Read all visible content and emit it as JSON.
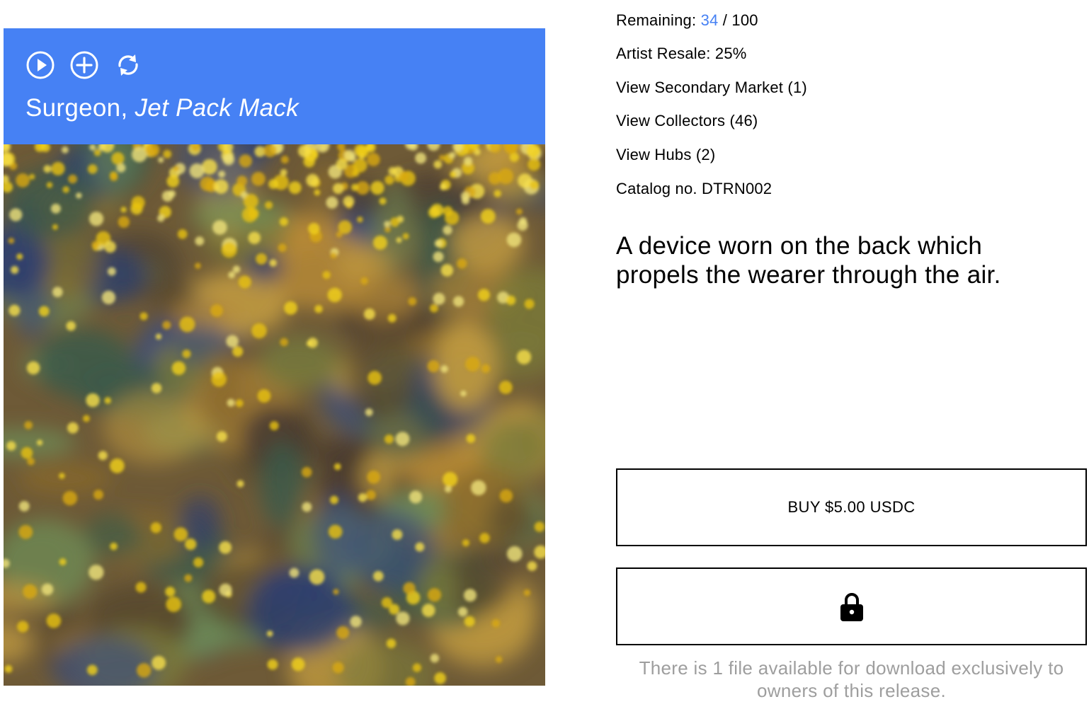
{
  "release": {
    "artist": "Surgeon",
    "title_separator": ", ",
    "title": "Jet Pack Mack",
    "description": "A device worn on the back which propels the wearer through the air."
  },
  "controls": [
    {
      "icon": "play-icon"
    },
    {
      "icon": "add-icon"
    },
    {
      "icon": "repeat-icon"
    }
  ],
  "meta": {
    "remaining_label": "Remaining: ",
    "remaining_count": "34",
    "remaining_total": " / 100",
    "artist_resale": "Artist Resale: 25%",
    "secondary_market": "View Secondary Market (1)",
    "collectors": "View Collectors (46)",
    "hubs": "View Hubs (2)",
    "catalog": "Catalog no. DTRN002"
  },
  "actions": {
    "buy_label": "BUY $5.00 USDC",
    "lock_icon": "lock-icon",
    "download_note": "There is 1 file available for download exclusively to owners of this release."
  },
  "colors": {
    "header_bg": "#4681f4",
    "accent": "#4681f4",
    "note_text": "#9e9e9e"
  }
}
